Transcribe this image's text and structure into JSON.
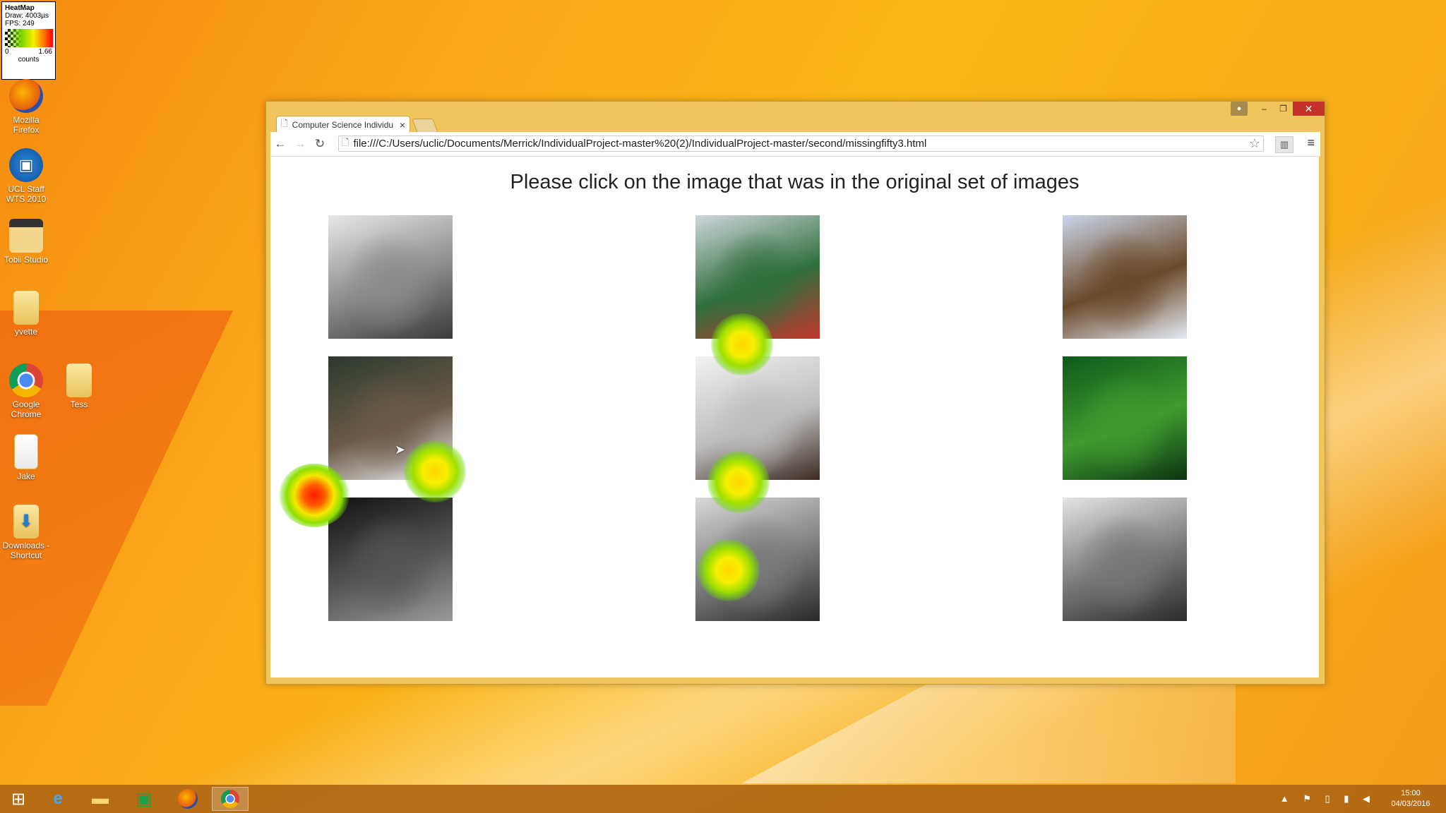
{
  "heatmap_legend": {
    "title": "HeatMap",
    "draw": "Draw: 4003µs",
    "fps": "FPS: 249",
    "min": "0",
    "max": "1.66",
    "unit": "counts",
    "colors": [
      "#000000",
      "#7bd400",
      "#f8f000",
      "#ff7800",
      "#ff0000"
    ]
  },
  "desktop_icons": [
    {
      "label": "Mozilla Firefox",
      "icon": "firefox-icon"
    },
    {
      "label": "UCL Staff WTS 2010",
      "icon": "remote-desktop-icon"
    },
    {
      "label": "Tobii Studio",
      "icon": "tobii-studio-icon"
    },
    {
      "label": "yvette",
      "icon": "folder-icon"
    },
    {
      "label": "Google Chrome",
      "icon": "chrome-icon"
    },
    {
      "label": "Tess",
      "icon": "folder-icon"
    },
    {
      "label": "Jake",
      "icon": "document-folder-icon"
    },
    {
      "label": "Downloads - Shortcut",
      "icon": "downloads-folder-icon"
    }
  ],
  "browser": {
    "tab_title": "Computer Science Individu",
    "url": "file:///C:/Users/uclic/Documents/Merrick/IndividualProject-master%20(2)/IndividualProject-master/second/missingfifty3.html"
  },
  "page": {
    "heading": "Please click on the image that was in the original set of images",
    "images": [
      {
        "subject": "sleeping-child",
        "colors": [
          "#e8e8e8",
          "#8a8a8a",
          "#3a3a3a"
        ]
      },
      {
        "subject": "train",
        "colors": [
          "#cfd6dc",
          "#2f6f3d",
          "#c2372c"
        ]
      },
      {
        "subject": "clock-tower",
        "colors": [
          "#cad6ea",
          "#6b4a2a",
          "#e3eaf5"
        ]
      },
      {
        "subject": "forest-headphones",
        "colors": [
          "#2b3a2d",
          "#6b5a4a",
          "#f0f0f0"
        ]
      },
      {
        "subject": "woman-in-snow",
        "colors": [
          "#f2f2f2",
          "#bdbdbd",
          "#3b2a22"
        ]
      },
      {
        "subject": "cucumbers",
        "colors": [
          "#0e5a1a",
          "#3f9b2e",
          "#0b3512"
        ]
      },
      {
        "subject": "keyboard",
        "colors": [
          "#111111",
          "#555555",
          "#999999"
        ]
      },
      {
        "subject": "plate-food",
        "colors": [
          "#d9d9d9",
          "#7a7a7a",
          "#2a2a2a"
        ]
      },
      {
        "subject": "bird",
        "colors": [
          "#e4e4e4",
          "#777777",
          "#2b2b2b"
        ]
      }
    ]
  },
  "taskbar": {
    "apps": [
      "windows-start-icon",
      "internet-explorer-icon",
      "file-explorer-icon",
      "store-icon",
      "firefox-icon",
      "chrome-icon"
    ],
    "time": "15:00",
    "date": "04/03/2016"
  }
}
